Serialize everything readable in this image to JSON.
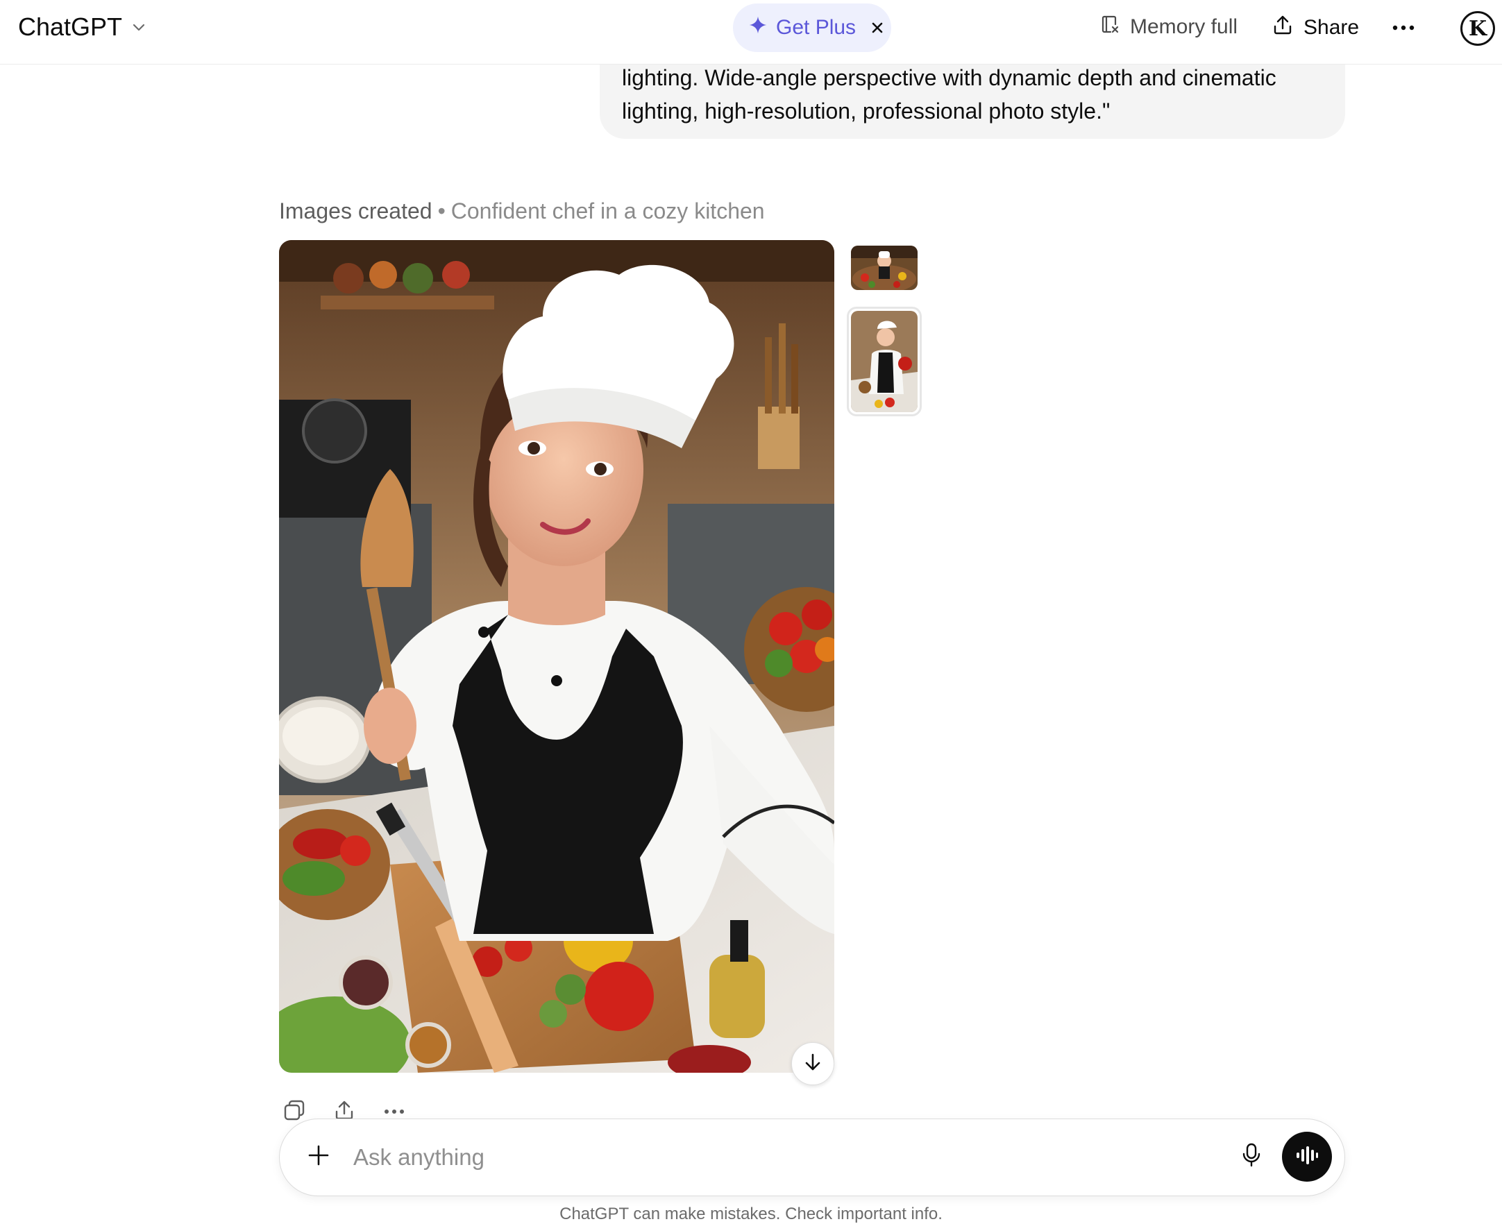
{
  "header": {
    "app_title": "ChatGPT",
    "get_plus_label": "Get Plus",
    "memory_label": "Memory full",
    "share_label": "Share",
    "avatar_letter": "K"
  },
  "user_message": {
    "line1": "lighting. Wide-angle perspective with dynamic depth and cinematic",
    "line2": "lighting, high-resolution, professional photo style.\""
  },
  "images": {
    "status": "Images created",
    "separator": "•",
    "subtitle": "Confident chef in a cozy kitchen",
    "image_count": 2,
    "selected_index": 1
  },
  "composer": {
    "placeholder": "Ask anything"
  },
  "footer": {
    "disclaimer": "ChatGPT can make mistakes. Check important info."
  },
  "icons": {
    "chevron": "chevron-down-icon",
    "sparkle": "sparkle-icon",
    "close": "close-icon",
    "memory": "memory-icon",
    "share": "share-icon",
    "more": "more-icon",
    "download": "download-icon",
    "copy": "copy-icon",
    "plus": "plus-icon",
    "mic": "mic-icon",
    "voice": "voice-mode-icon"
  },
  "colors": {
    "accent": "#5b57d9",
    "get_plus_bg": "#eef0fd",
    "bubble_bg": "#f4f4f4",
    "voice_button_bg": "#0d0d0d"
  }
}
